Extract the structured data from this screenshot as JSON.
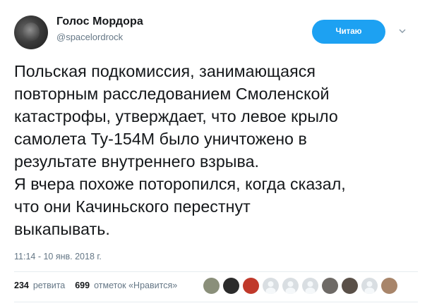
{
  "author": {
    "display_name": "Голос Мордора",
    "handle": "@spacelordrock"
  },
  "follow_button": {
    "label": "Читаю"
  },
  "tweet": {
    "text": "Польская подкомиссия, занимающаяся\nповторным расследованием Смоленской\nкатастрофы, утверждает, что левое крыло\nсамолета Ту-154М было уничтожено в\nрезультате внутреннего взрыва.\nЯ вчера похоже поторопился, когда сказал,\nчто они Качиньского перестнут\nвыкапывать.",
    "timestamp": "11:14 - 10 янв. 2018 г."
  },
  "stats": {
    "retweets_count": "234",
    "retweets_label": "ретвита",
    "likes_count": "699",
    "likes_label": "отметок «Нравится»"
  },
  "liker_avatars": [
    {
      "icon": "user-avatar-icon",
      "color": "#8a8f7a"
    },
    {
      "icon": "user-avatar-icon",
      "color": "#2b2b2b"
    },
    {
      "icon": "user-avatar-icon",
      "color": "#c0392b"
    },
    {
      "icon": "user-avatar-icon",
      "color": "#d9dee2"
    },
    {
      "icon": "user-avatar-icon",
      "color": "#d9dee2"
    },
    {
      "icon": "user-avatar-icon",
      "color": "#d9dee2"
    },
    {
      "icon": "user-avatar-icon",
      "color": "#6e6a66"
    },
    {
      "icon": "user-avatar-icon",
      "color": "#5a5048"
    },
    {
      "icon": "user-avatar-icon",
      "color": "#d9dee2"
    },
    {
      "icon": "user-avatar-icon",
      "color": "#a8856a"
    }
  ],
  "colors": {
    "accent": "#1da1f2",
    "text": "#14171a",
    "secondary": "#657786",
    "divider": "#e6ecf0"
  }
}
